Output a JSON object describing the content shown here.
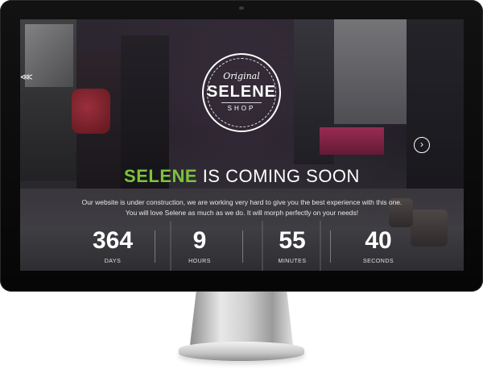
{
  "badge": {
    "top": "Original",
    "main": "SELENE",
    "sub": "SHOP"
  },
  "headline": {
    "accent": "SELENE",
    "rest": " IS COMING SOON"
  },
  "message": {
    "line1": "Our website is under construction, we are working very hard to give you the best experience with this one.",
    "line2": "You will love Selene as much as we do. It will morph perfectly on your needs!"
  },
  "countdown": [
    {
      "value": "364",
      "label": "DAYS"
    },
    {
      "value": "9",
      "label": "HOURS"
    },
    {
      "value": "55",
      "label": "MINUTES"
    },
    {
      "value": "40",
      "label": "SECONDS"
    }
  ],
  "controls": {
    "share_glyph": "⋘",
    "next_glyph": "›"
  },
  "icons": {
    "share": "share-icon",
    "next": "chevron-right-icon"
  },
  "colors": {
    "accent": "#7cc43c",
    "text": "#ffffff"
  }
}
